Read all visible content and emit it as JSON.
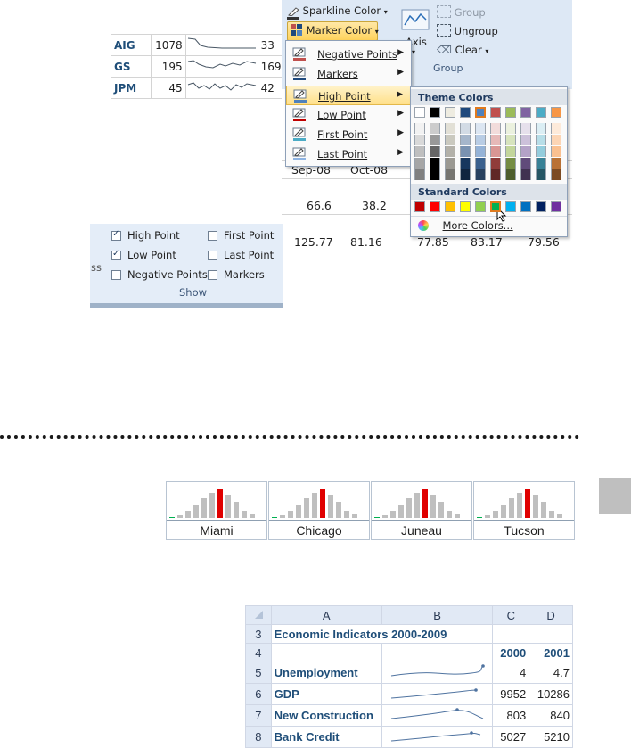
{
  "sparkline_table": {
    "rows": [
      {
        "ticker": "AIG",
        "first": "1078",
        "last": "33"
      },
      {
        "ticker": "GS",
        "first": "195",
        "last": "169"
      },
      {
        "ticker": "JPM",
        "first": "45",
        "last": "42"
      }
    ]
  },
  "ribbon": {
    "sparkline_color": "Sparkline Color",
    "marker_color": "Marker Color",
    "axis": "Axis",
    "group": "Group",
    "ungroup": "Ungroup",
    "clear": "Clear",
    "group_label": "Group"
  },
  "marker_menu": {
    "items": [
      {
        "label": "Negative Points",
        "icon": "negative-points-icon"
      },
      {
        "label": "Markers",
        "icon": "markers-icon"
      },
      {
        "label": "High Point",
        "icon": "high-point-icon"
      },
      {
        "label": "Low Point",
        "icon": "low-point-icon"
      },
      {
        "label": "First Point",
        "icon": "first-point-icon"
      },
      {
        "label": "Last Point",
        "icon": "last-point-icon"
      }
    ]
  },
  "palette": {
    "theme_title": "Theme Colors",
    "standard_title": "Standard Colors",
    "more_colors": "More Colors...",
    "theme_base": [
      "#ffffff",
      "#000000",
      "#eeece1",
      "#1f497d",
      "#4f81bd",
      "#c0504d",
      "#9bbb59",
      "#8064a2",
      "#4bacc6",
      "#f79646"
    ],
    "standard": [
      "#c00000",
      "#ff0000",
      "#ffc000",
      "#ffff00",
      "#92d050",
      "#00b050",
      "#00b0f0",
      "#0070c0",
      "#002060",
      "#7030a0"
    ]
  },
  "sheet_behind": {
    "headers": [
      "Sep-08",
      "Oct-08"
    ],
    "row1": [
      "66.6",
      "38.2"
    ],
    "row2": [
      "125.77",
      "81.16",
      "77.85",
      "83.17",
      "79.56"
    ]
  },
  "show_group": {
    "high_point": "High Point",
    "low_point": "Low Point",
    "negative_points": "Negative Points",
    "first_point": "First Point",
    "last_point": "Last Point",
    "markers": "Markers",
    "caption": "Show",
    "partial_left": "ss"
  },
  "weather": {
    "cities": [
      "Miami",
      "Chicago",
      "Juneau",
      "Tucson"
    ],
    "bar_color": "#bfbfbf",
    "high_color": "#e00000",
    "low_color": "#00b050"
  },
  "econ": {
    "col_headers": [
      "A",
      "B",
      "C",
      "D"
    ],
    "row_numbers": [
      "3",
      "4",
      "5",
      "6",
      "7",
      "8"
    ],
    "title": "Economic Indicators 2000-2009",
    "years": [
      "2000",
      "2001"
    ],
    "rows": [
      {
        "label": "Unemployment",
        "v2000": "4",
        "v2001": "4.7"
      },
      {
        "label": "GDP",
        "v2000": "9952",
        "v2001": "10286"
      },
      {
        "label": "New Construction",
        "v2000": "803",
        "v2001": "840"
      },
      {
        "label": "Bank Credit",
        "v2000": "5027",
        "v2001": "5210"
      }
    ]
  }
}
